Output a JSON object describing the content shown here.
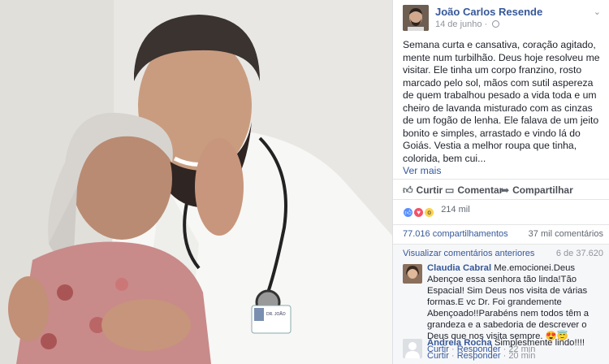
{
  "post": {
    "author": "João Carlos Resende",
    "date": "14 de junho",
    "dot": "·",
    "text": "Semana curta e cansativa, coração agitado, mente num turbilhão. Deus hoje resolveu me visitar. Ele tinha um corpo franzino, rosto marcado pelo sol, mãos com sutil aspereza de quem trabalhou pesado a vida toda e um cheiro de lavanda misturado com as cinzas de um fogão de lenha. Ele falava de um jeito bonito e simples, arrastado e vindo lá do Goiás. Vestia a melhor roupa que tinha, colorida, bem cui...",
    "see_more": "Ver mais",
    "menu_icon": "chevron-down-icon"
  },
  "actions": {
    "like": "Curtir",
    "comment": "Comentar",
    "share": "Compartilhar"
  },
  "reactions": {
    "count": "214 mil",
    "types": [
      "like",
      "love",
      "wow"
    ],
    "colors": {
      "like": "#5890ff",
      "love": "#f25268",
      "wow": "#fcd250"
    }
  },
  "stats": {
    "shares": "77.016 compartilhamentos",
    "comments": "37 mil comentários"
  },
  "comments_section": {
    "view_previous": "Visualizar comentários anteriores",
    "count": "6 de 37.620",
    "items": [
      {
        "name": "Claudia Cabral",
        "text": "Me.emocionei.Deus Abençoe essa senhora tão linda!Tão Espacial! Sim Deus nos visita de várias formas.E vc Dr. Foi grandemente Abençoado!!Parabéns nem todos têm a grandeza e a sabedoria de descrever o Deus que nos visita sempre. 😍😇",
        "like": "Curtir",
        "reply": "Responder",
        "sep": "·",
        "time": "22 min"
      },
      {
        "name": "Andreia Rocha",
        "text": "Simplesmente lindo!!!!",
        "like": "Curtir",
        "reply": "Responder",
        "sep": "·",
        "time": "20 min"
      }
    ]
  },
  "photo": {
    "badge_name": "DR. JOÃO"
  }
}
